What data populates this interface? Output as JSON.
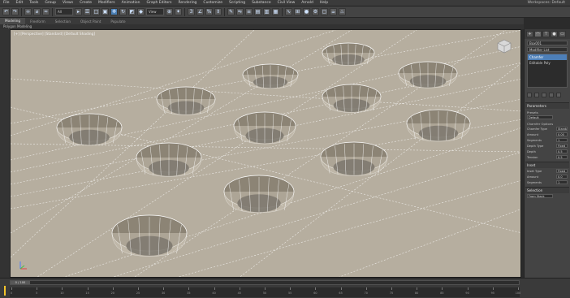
{
  "menu": {
    "items": [
      "File",
      "Edit",
      "Tools",
      "Group",
      "Views",
      "Create",
      "Modifiers",
      "Animation",
      "Graph Editors",
      "Rendering",
      "Customize",
      "Scripting",
      "Substance",
      "Civil View",
      "Arnold",
      "Help"
    ],
    "workspace": "Workspaces: Default"
  },
  "toolbar": {
    "selection_filter": "All",
    "view_ref": "View"
  },
  "ribbon": {
    "tabs": [
      "Modeling",
      "Freeform",
      "Selection",
      "Object Paint",
      "Populate"
    ],
    "active_tab": "Modeling",
    "sub_label": "Polygon Modeling"
  },
  "viewport": {
    "label": "[+] [Perspective] [Standard] [Default Shading]",
    "background": "#b6ae9f"
  },
  "command_panel": {
    "object_name": "Box001",
    "modifier_list": "Modifier List",
    "stack": [
      "Chamfer",
      "Editable Poly"
    ],
    "parameters_title": "Parameters",
    "presets_label": "Presets",
    "presets_value": "Default",
    "chamfer_options_label": "Chamfer Options",
    "chamfer_type_label": "Chamfer Type",
    "chamfer_type_value": "Standard",
    "amount_label": "Amount",
    "amount_value": "0.00",
    "segments_label": "Segments",
    "segments_value": "1",
    "depth_type_label": "Depth Type",
    "depth_type_value": "Fixed",
    "depth_label": "Depth",
    "depth_value": "0.5",
    "tension_label": "Tension",
    "tension_value": "0.5",
    "inset_title": "Inset",
    "inset_type_label": "Inset Type",
    "inset_type_value": "Fixed",
    "inset_amount_label": "Amount",
    "inset_amount_value": "0.0",
    "inset_segments_label": "Segments",
    "inset_segments_value": "1",
    "selection_title": "Selection",
    "selection_value": "From Stack"
  },
  "timeline": {
    "thumb": "0 / 100",
    "ticks": [
      "0",
      "5",
      "10",
      "15",
      "20",
      "25",
      "30",
      "35",
      "40",
      "45",
      "50",
      "55",
      "60",
      "65",
      "70",
      "75",
      "80",
      "85",
      "90",
      "95",
      "100"
    ]
  },
  "colors": {
    "viewport_bg": "#b6ae9f",
    "wire": "#ffffff",
    "selection_blue": "#4d7fb8",
    "key_yellow": "#f3c42b"
  }
}
